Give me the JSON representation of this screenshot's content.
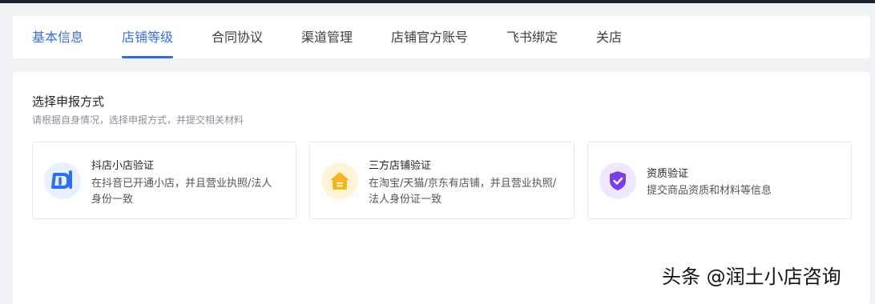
{
  "tabs": [
    {
      "label": "基本信息"
    },
    {
      "label": "店铺等级"
    },
    {
      "label": "合同协议"
    },
    {
      "label": "渠道管理"
    },
    {
      "label": "店铺官方账号"
    },
    {
      "label": "飞书绑定"
    },
    {
      "label": "关店"
    }
  ],
  "active_tab": "店铺等级",
  "section": {
    "title": "选择申报方式",
    "subtitle": "请根据自身情况，选择申报方式，并提交相关材料"
  },
  "options": [
    {
      "title": "抖店小店验证",
      "desc": "在抖音已开通小店，并且营业执照/法人身份一致",
      "icon": "douyin-shop-icon",
      "icon_color": "#2d6ff2"
    },
    {
      "title": "三方店铺验证",
      "desc": "在淘宝/天猫/京东有店铺，并且营业执照/法人身份证一致",
      "icon": "store-icon",
      "icon_color": "#f4b81f"
    },
    {
      "title": "资质验证",
      "desc": "提交商品资质和材料等信息",
      "icon": "shield-check-icon",
      "icon_color": "#7a3ee6"
    }
  ],
  "watermark": "头条 @润土小店咨询",
  "colors": {
    "accent": "#2f6bdc",
    "page_bg": "#f0f2f5",
    "topbar": "#1b2230"
  }
}
